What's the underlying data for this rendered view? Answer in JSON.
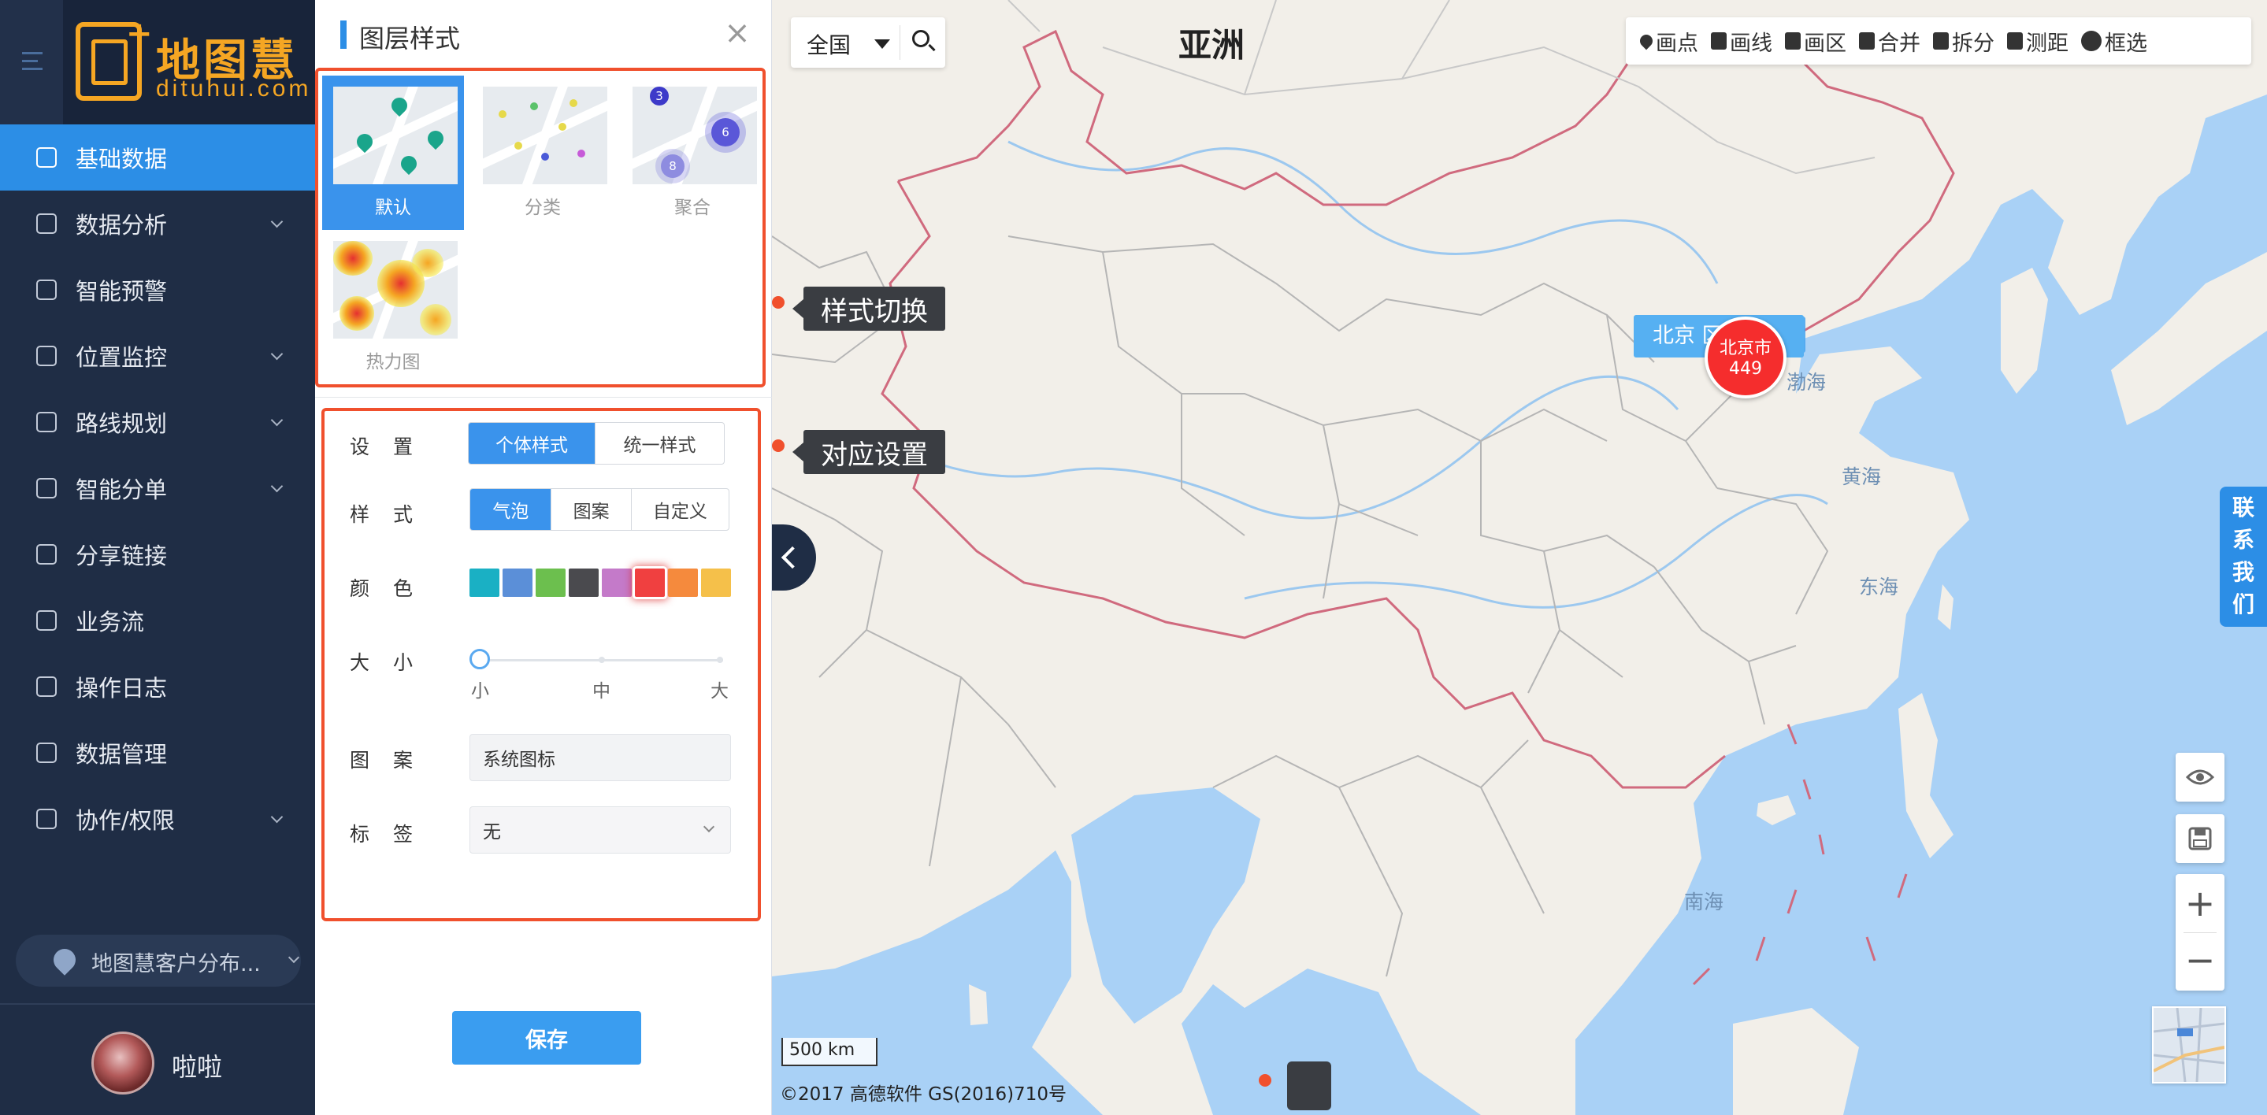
{
  "app": {
    "logo_cn": "地图慧",
    "logo_en": "dituhui.com",
    "logo_plus": "+"
  },
  "sidebar": {
    "items": [
      {
        "label": "基础数据",
        "icon": "database-icon",
        "expandable": false,
        "active": true
      },
      {
        "label": "数据分析",
        "icon": "analytics-icon",
        "expandable": true,
        "active": false
      },
      {
        "label": "智能预警",
        "icon": "alert-icon",
        "expandable": false,
        "active": false
      },
      {
        "label": "位置监控",
        "icon": "location-icon",
        "expandable": true,
        "active": false
      },
      {
        "label": "路线规划",
        "icon": "route-icon",
        "expandable": true,
        "active": false
      },
      {
        "label": "智能分单",
        "icon": "dispatch-icon",
        "expandable": true,
        "active": false
      },
      {
        "label": "分享链接",
        "icon": "share-icon",
        "expandable": false,
        "active": false
      },
      {
        "label": "业务流",
        "icon": "workflow-icon",
        "expandable": false,
        "active": false
      },
      {
        "label": "操作日志",
        "icon": "log-icon",
        "expandable": false,
        "active": false
      },
      {
        "label": "数据管理",
        "icon": "data-manage-icon",
        "expandable": false,
        "active": false
      },
      {
        "label": "协作/权限",
        "icon": "users-icon",
        "expandable": true,
        "active": false
      }
    ],
    "project": "地图慧客户分布...",
    "username": "啦啦"
  },
  "panel": {
    "title": "图层样式",
    "close": "×",
    "style_options": [
      {
        "label": "默认",
        "active": true
      },
      {
        "label": "分类",
        "active": false
      },
      {
        "label": "聚合",
        "active": false
      },
      {
        "label": "热力图",
        "active": false
      }
    ],
    "cluster_numbers": [
      "3",
      "6",
      "8"
    ],
    "settings": {
      "setting_label": "设置",
      "setting_options": [
        "个体样式",
        "统一样式"
      ],
      "setting_selected": "个体样式",
      "style_label": "样式",
      "style_options": [
        "气泡",
        "图案",
        "自定义"
      ],
      "style_selected": "气泡",
      "color_label": "颜色",
      "colors": [
        "#1ab0c4",
        "#5b8fd8",
        "#6cbf4e",
        "#4a4a4e",
        "#c47ac9",
        "#f04040",
        "#f58a3d",
        "#f5c04a"
      ],
      "color_selected": "#f04040",
      "size_label": "大小",
      "size_marks": [
        "小",
        "中",
        "大"
      ],
      "size_value": 0,
      "pattern_label": "图案",
      "pattern_value": "系统图标",
      "tag_label": "标签",
      "tag_value": "无"
    },
    "save_label": "保存"
  },
  "map": {
    "continent": "亚洲",
    "region": "全国",
    "tools": [
      "画点",
      "画线",
      "画区",
      "合并",
      "拆分",
      "测距",
      "框选"
    ],
    "contact_us": [
      "联",
      "系",
      "我",
      "们"
    ],
    "places": {
      "bohai": "渤海",
      "yellow_sea": "黄海",
      "east_sea": "东海",
      "south_sea": "南海"
    },
    "marker": {
      "name": "北京市",
      "count": "449"
    },
    "marker_tag": "北京 区",
    "scale": "500 km",
    "copyright": "©2017 高德软件 GS(2016)710号",
    "callouts": [
      "样式切换",
      "对应设置"
    ],
    "zoom_in": "+",
    "zoom_out": "−",
    "colors": {
      "water": "#a8d1f7",
      "land": "#f2efe9",
      "border": "#d06a7e",
      "accent": "#2c8ee6"
    }
  }
}
